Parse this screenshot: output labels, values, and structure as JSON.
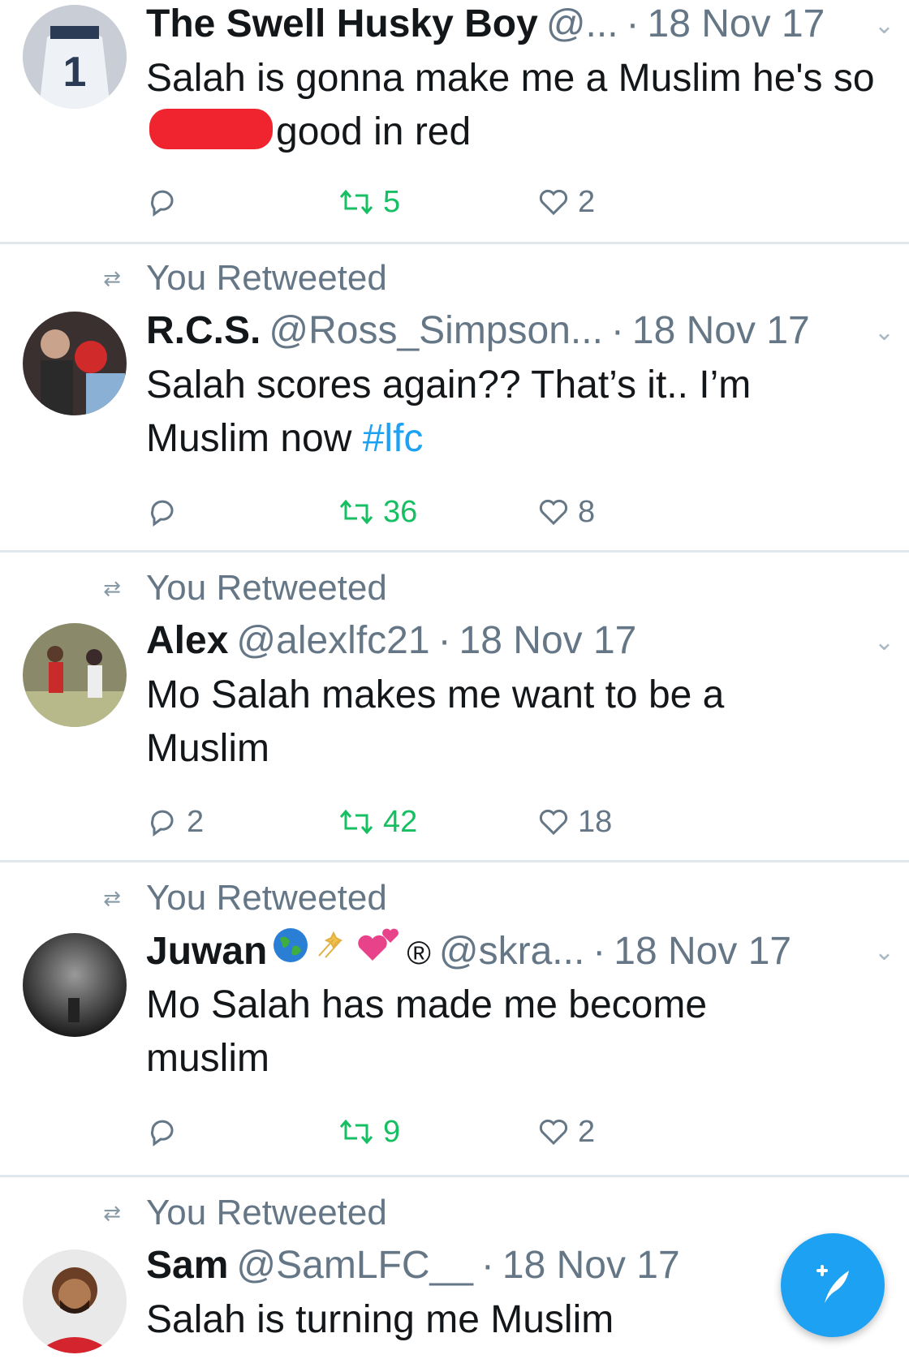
{
  "tweets": [
    {
      "retweet_label": "",
      "name": "The Swell Husky Boy",
      "handle": "@...",
      "time": "18 Nov 17",
      "text_before": "Salah is gonna make me a Muslim he's so",
      "text_after": "good in red",
      "replies": "",
      "retweets": "5",
      "likes": "2"
    },
    {
      "retweet_label": "You Retweeted",
      "name": "R.C.S.",
      "handle": "@Ross_Simpson...",
      "time": "18 Nov 17",
      "text": "Salah scores again?? That’s it.. I’m Muslim now",
      "hashtag": "#lfc",
      "replies": "",
      "retweets": "36",
      "likes": "8"
    },
    {
      "retweet_label": "You Retweeted",
      "name": "Alex",
      "handle": "@alexlfc21",
      "time": "18 Nov 17",
      "text": "Mo Salah makes me want to be a Muslim",
      "replies": "2",
      "retweets": "42",
      "likes": "18"
    },
    {
      "retweet_label": "You Retweeted",
      "name": "Juwan",
      "name_suffix": "®",
      "handle": "@skra...",
      "time": "18 Nov 17",
      "text": "Mo Salah has made me become muslim",
      "replies": "",
      "retweets": "9",
      "likes": "2"
    },
    {
      "retweet_label": "You Retweeted",
      "name": "Sam",
      "handle": "@SamLFC__",
      "time": "18 Nov 17",
      "text": "Salah is turning me Muslim"
    }
  ],
  "dot_separator": "·",
  "colors": {
    "accent": "#1da1f2",
    "retweet_green": "#17bf63",
    "secondary_text": "#657786",
    "redaction": "#f0242e"
  }
}
